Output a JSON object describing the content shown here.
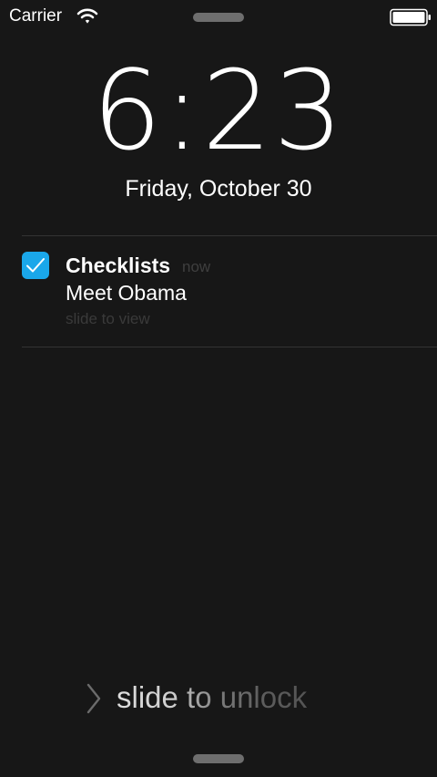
{
  "status_bar": {
    "carrier": "Carrier",
    "wifi_icon": "wifi-icon",
    "battery_icon": "battery-icon"
  },
  "lock_screen": {
    "time": "6:23",
    "date": "Friday, October 30"
  },
  "notification": {
    "app_icon": "checkmark-checkbox-icon",
    "app_name": "Checklists",
    "timestamp": "now",
    "message": "Meet Obama",
    "action_hint": "slide to view"
  },
  "unlock": {
    "chevron_icon": "chevron-right-icon",
    "label": "slide to unlock"
  },
  "colors": {
    "background": "#171717",
    "app_icon_accent": "#1aa7ea",
    "text_primary": "#ffffff",
    "text_muted": "#3f3f3f"
  }
}
